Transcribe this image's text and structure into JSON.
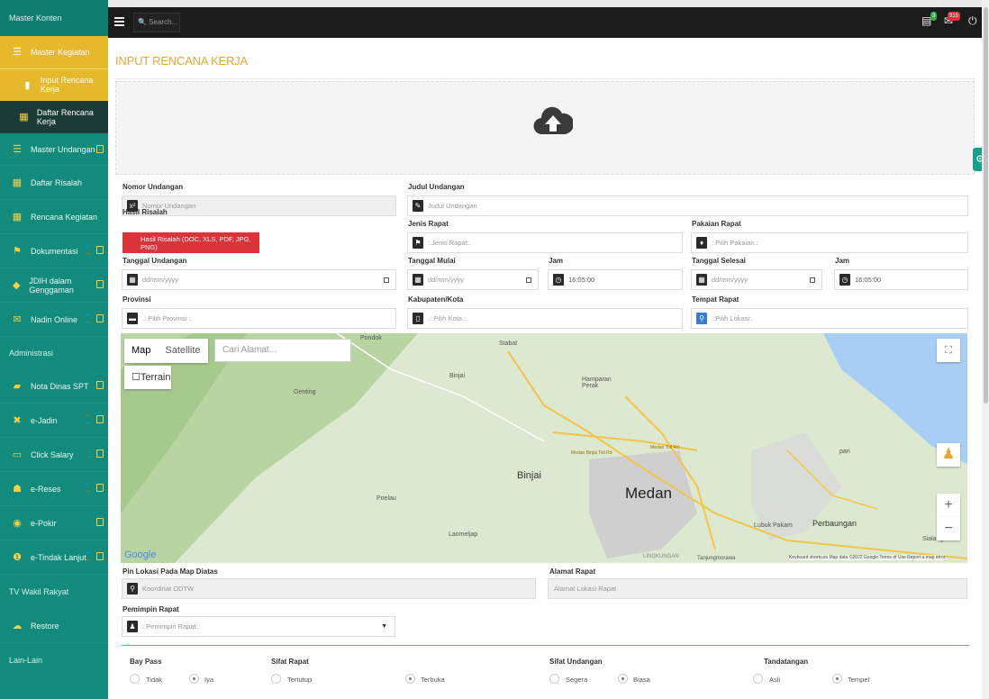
{
  "sidebar": {
    "section_master": "Master Konten",
    "items": [
      {
        "label": "Master Kegiatan",
        "icon": "list-icon"
      },
      {
        "label": "Input Rencana Kerja",
        "icon": "document-icon"
      },
      {
        "label": "Daftar Rencana Kerja",
        "icon": "table-icon"
      },
      {
        "label": "Master Undangan",
        "icon": "list-icon"
      },
      {
        "label": "Daftar Risalah",
        "icon": "table-icon"
      },
      {
        "label": "Rencana Kegiatan",
        "icon": "calendar-icon"
      },
      {
        "label": "Dokumentasi",
        "icon": "flag-icon"
      },
      {
        "label": "JDIH dalam Genggaman",
        "icon": "shop-icon"
      },
      {
        "label": "Nadin Online",
        "icon": "mail-icon"
      }
    ],
    "section_admin": "Administrasi",
    "admin_items": [
      {
        "label": "Nota Dinas SPT",
        "icon": "note-icon"
      },
      {
        "label": "e-Jadin",
        "icon": "tools-icon"
      },
      {
        "label": "Click Salary",
        "icon": "monitor-icon"
      },
      {
        "label": "e-Reses",
        "icon": "users-icon"
      },
      {
        "label": "e-Pokir",
        "icon": "target-icon"
      },
      {
        "label": "e-Tindak Lanjut",
        "icon": "alert-icon"
      }
    ],
    "section_tv": "TV Wakil Rakyat",
    "restore": "Restore",
    "section_lain": "Lain-Lain"
  },
  "topbar": {
    "search_placeholder": "Search...",
    "badge_tasks": "3",
    "badge_messages": "915"
  },
  "page": {
    "title": "INPUT RENCANA KERJA"
  },
  "form": {
    "nomor_label": "Nomor Undangan",
    "nomor_ph": "Nomor Undangan",
    "judul_label": "Judul Undangan",
    "judul_ph": "Judul Undangan",
    "risalah_label": "Hasil Risalah",
    "risalah_btn": "Hasil Risalah (DOC, XLS, PDF, JPG, PNG)",
    "jenis_label": "Jenis Rapat",
    "jenis_ph": ":.Jenis Rapat:.",
    "pakaian_label": "Pakaian Rapat",
    "pakaian_ph": ":.Pilih Pakaian.:",
    "tgl_und_label": "Tanggal Undangan",
    "tgl_und_ph": "dd/mm/yyyy",
    "tgl_mulai_label": "Tanggal Mulai",
    "tgl_mulai_ph": "dd/mm/yyyy",
    "jam1_label": "Jam",
    "jam1_val": "16:05:00",
    "tgl_selesai_label": "Tanggal Selesai",
    "tgl_selesai_ph": "dd/mm/yyyy",
    "jam2_label": "Jam",
    "jam2_val": "16:05:00",
    "provinsi_label": "Provinsi",
    "provinsi_ph": ".: Pilih Provinsi :.",
    "kab_label": "Kabupaten/Kota",
    "kab_ph": ".: Pilih Kota :.",
    "tempat_label": "Tempat Rapat",
    "tempat_ph": ".:Pilih Lokasi:.",
    "pin_label": "Pin Lokasi Pada Map Diatas",
    "pin_ph": "Koordinat ODTW",
    "alamat_label": "Alamat Rapat",
    "alamat_ph": "Alamat Lokasi Rapat",
    "pemimpin_label": "Pemimpin Rapat",
    "pemimpin_ph": ":.Pemimpin Rapat:."
  },
  "map": {
    "tab_map": "Map",
    "tab_satellite": "Satellite",
    "search_ph": "Cari Alamat...",
    "terrain": "Terrain",
    "places": [
      "Pondok",
      "Stabat",
      "Binjai",
      "Hamparan Perak",
      "Genting",
      "Binjai",
      "Medan",
      "Poelau",
      "Laomeljap",
      "Lubuk Pakam",
      "Perbaungan",
      "pari",
      "Sialang",
      "LINGKUNGAN",
      "Tanjungmorawa",
      "Medan Binjai Toll Rd",
      "Medan Toll Rd"
    ],
    "google": "Google",
    "footer": "Keyboard shortcuts   Map data ©2022 Google   Terms of Use   Report a map error"
  },
  "radios": {
    "baypass_label": "Bay Pass",
    "tidak": "Tidak",
    "iya": "Iya",
    "sifat_rapat_label": "Sifat Rapat",
    "tertutup": "Tertutup",
    "terbuka": "Terbuka",
    "sifat_und_label": "Sifat Undangan",
    "segera": "Segera",
    "biasa": "Biasa",
    "ttd_label": "Tandatangan",
    "asli": "Asli",
    "tempel": "Tempel"
  }
}
